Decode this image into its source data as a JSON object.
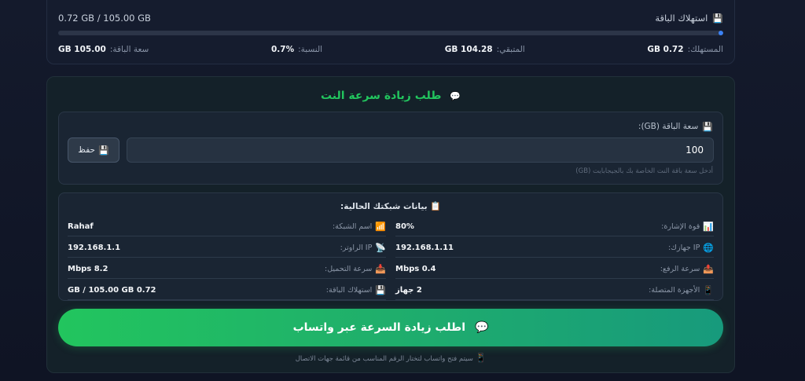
{
  "usage": {
    "title": "استهلاك الباقة",
    "title_icon": "floppy-disk-icon",
    "summary": "0.72 GB / 105.00 GB",
    "progress_percent": 0.7,
    "stats": {
      "used_label": "المستهلك:",
      "used_value": "0.72 GB",
      "remaining_label": "المتبقي:",
      "remaining_value": "104.28 GB",
      "ratio_label": "النسبة:",
      "ratio_value": "0.7%",
      "capacity_label": "سعة الباقة:",
      "capacity_value": "105.00 GB"
    }
  },
  "request": {
    "title": "طلب زيادة سرعة النت",
    "title_icon": "speech-bubble-icon",
    "capacity_field": {
      "label": "سعة الباقة (GB):",
      "label_icon": "floppy-disk-icon",
      "value": "100",
      "hint": "أدخل سعة باقة النت الخاصة بك بالجيجابايت (GB)"
    },
    "save_button": {
      "label": "حفظ",
      "icon": "floppy-disk-icon"
    },
    "network_info": {
      "title": "بيانات شبكتك الحالية:",
      "title_icon": "clipboard-icon",
      "rows": [
        {
          "label": "اسم الشبكة:",
          "value": "Rahaf",
          "icon": "signal-bars-icon"
        },
        {
          "label": "قوة الإشارة:",
          "value": "80%",
          "icon": "chart-icon"
        },
        {
          "label": "IP الراوتر:",
          "value": "192.168.1.1",
          "icon": "satellite-icon"
        },
        {
          "label": "IP جهازك:",
          "value": "192.168.1.11",
          "icon": "globe-icon"
        },
        {
          "label": "سرعة التحميل:",
          "value": "8.2 Mbps",
          "icon": "download-icon"
        },
        {
          "label": "سرعة الرفع:",
          "value": "0.4 Mbps",
          "icon": "upload-icon"
        },
        {
          "label": "استهلاك الباقة:",
          "value": "0.72 GB / 105.00 GB",
          "icon": "floppy-disk-icon"
        },
        {
          "label": "الأجهزة المتصلة:",
          "value": "2 جهاز",
          "icon": "devices-icon"
        }
      ]
    },
    "whatsapp_button": {
      "label": "اطلب زيادة السرعة عبر واتساب",
      "icon": "speech-bubble-icon"
    },
    "footer_note": "سيتم فتح واتساب لتختار الرقم المناسب من قائمة جهات الاتصال",
    "footer_icon": "phone-icon"
  },
  "colors": {
    "accent_green": "#22c55e",
    "progress_blue": "#3b82f6",
    "background": "#141a2c"
  }
}
